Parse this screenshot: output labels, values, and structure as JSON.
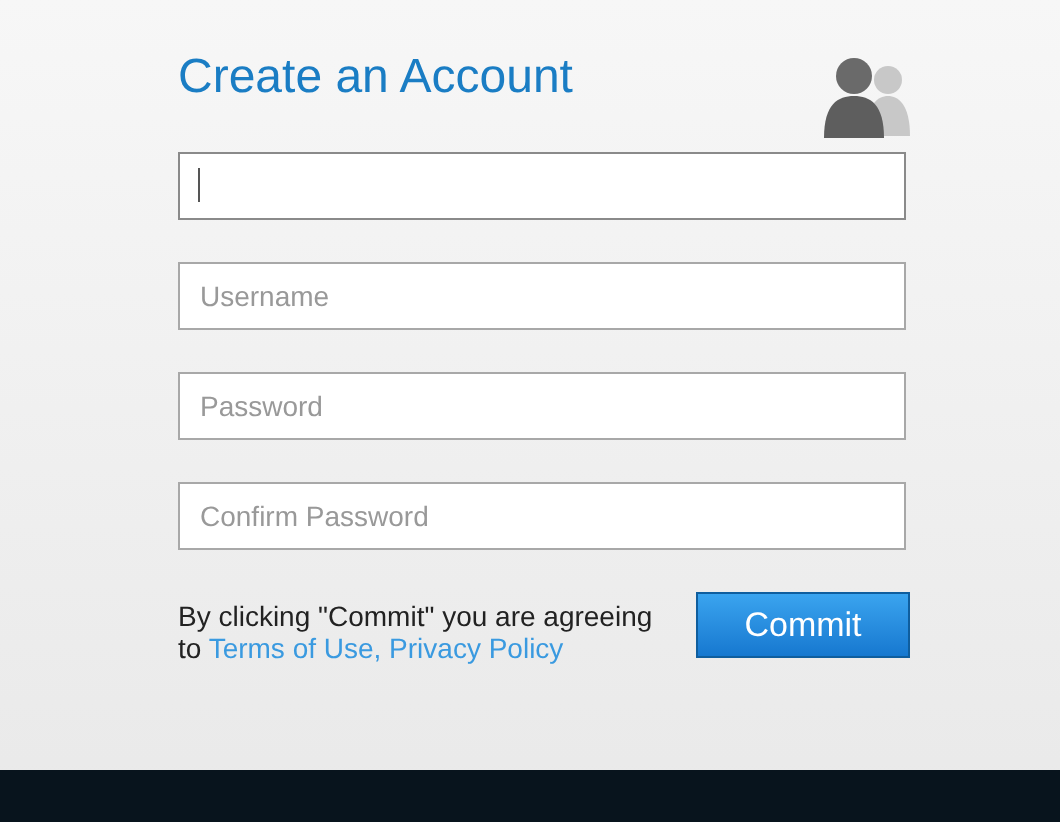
{
  "title": "Create an Account",
  "fields": [
    {
      "focused": true
    },
    {
      "placeholder": "Username",
      "focused": false
    },
    {
      "placeholder": "Password",
      "focused": false
    },
    {
      "placeholder": "Confirm Password",
      "focused": false
    }
  ],
  "agreement": {
    "text": "By clicking \"Commit\" you are agreeing to",
    "link": "Terms of Use, Privacy Policy"
  },
  "button": "Commit"
}
